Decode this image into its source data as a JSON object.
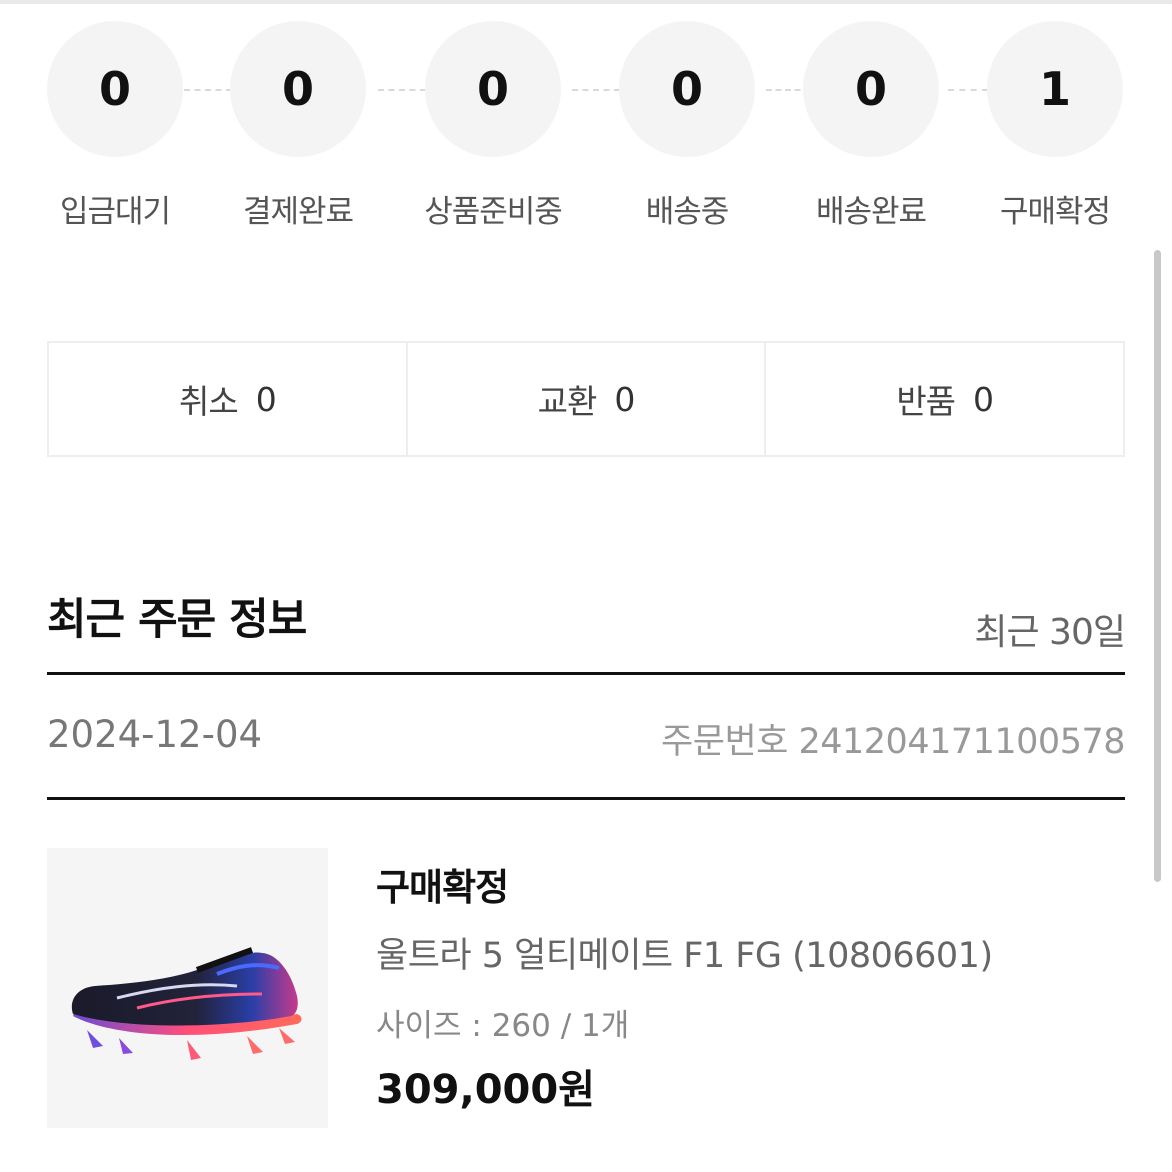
{
  "order_status_steps": [
    {
      "label": "입금대기",
      "count": "0"
    },
    {
      "label": "결제완료",
      "count": "0"
    },
    {
      "label": "상품준비중",
      "count": "0"
    },
    {
      "label": "배송중",
      "count": "0"
    },
    {
      "label": "배송완료",
      "count": "0"
    },
    {
      "label": "구매확정",
      "count": "1"
    }
  ],
  "claims": [
    {
      "label": "취소",
      "count": "0"
    },
    {
      "label": "교환",
      "count": "0"
    },
    {
      "label": "반품",
      "count": "0"
    }
  ],
  "recent_orders": {
    "title": "최근 주문 정보",
    "range": "최근 30일",
    "order": {
      "date": "2024-12-04",
      "order_number": "주문번호 241204171100578",
      "item": {
        "status": "구매확정",
        "name": "울트라 5 얼티메이트 F1 FG (10806601)",
        "option": "사이즈 : 260 / 1개",
        "price": "309,000원",
        "image": "shoe-product-image"
      }
    }
  }
}
